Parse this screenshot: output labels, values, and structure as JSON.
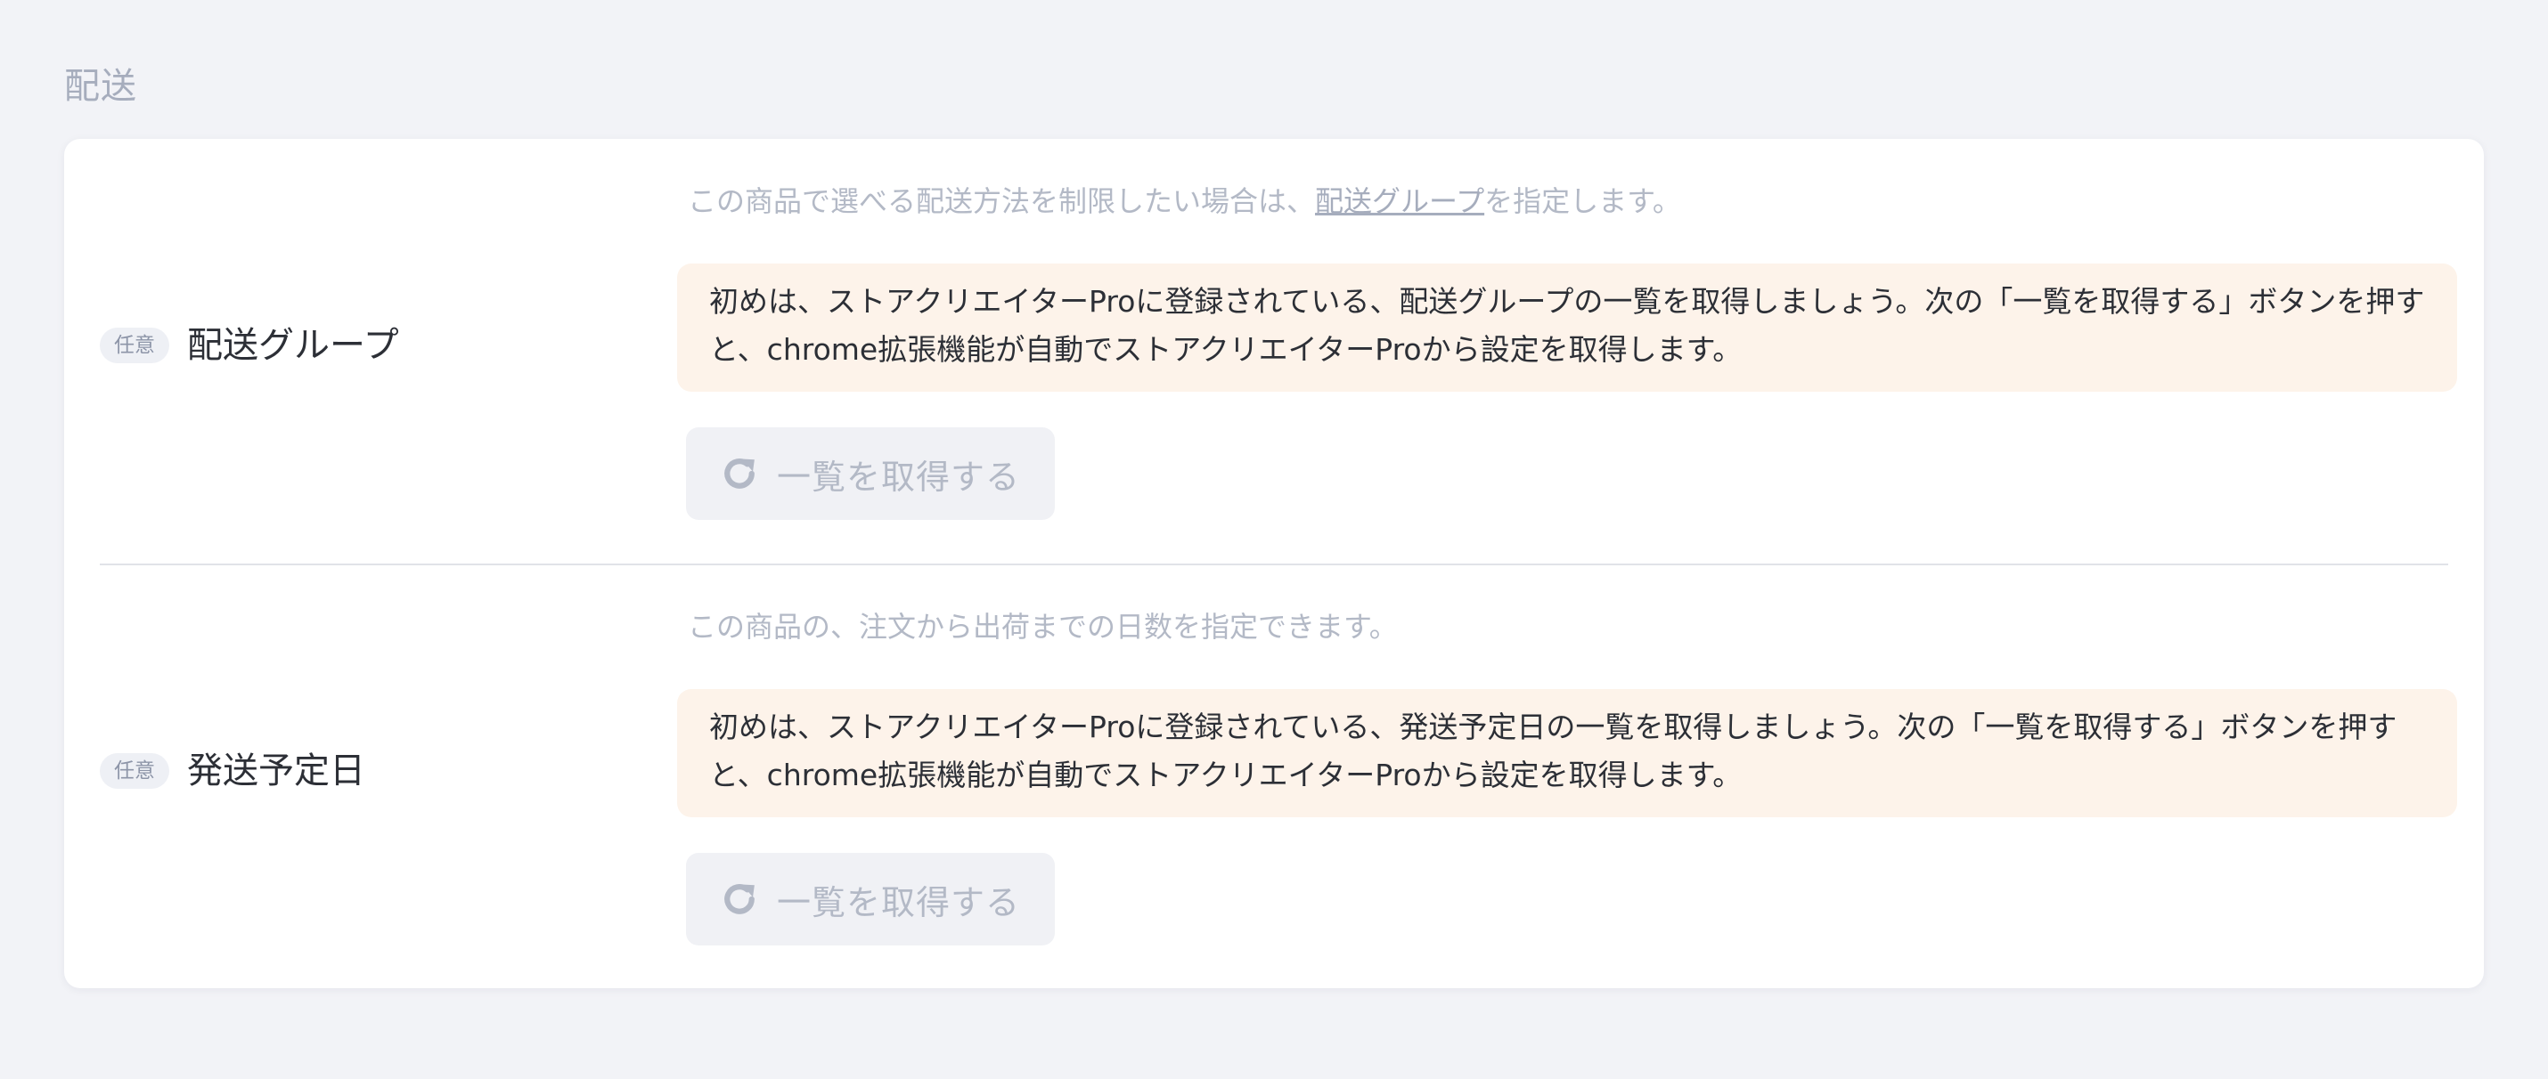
{
  "section": {
    "title": "配送"
  },
  "fields": [
    {
      "badge": "任意",
      "label": "配送グループ",
      "help_prefix": "この商品で選べる配送方法を制限したい場合は、",
      "help_link": "配送グループ",
      "help_suffix": "を指定します。",
      "notice": "初めは、ストアクリエイターProに登録されている、配送グループの一覧を取得しましょう。次の「一覧を取得する」ボタンを押すと、chrome拡張機能が自動でストアクリエイターProから設定を取得します。",
      "button_label": "一覧を取得する",
      "button_icon": "refresh-icon"
    },
    {
      "badge": "任意",
      "label": "発送予定日",
      "help_prefix": "この商品の、注文から出荷までの日数を指定できます。",
      "notice": "初めは、ストアクリエイターProに登録されている、発送予定日の一覧を取得しましょう。次の「一覧を取得する」ボタンを押すと、chrome拡張機能が自動でストアクリエイターProから設定を取得します。",
      "button_label": "一覧を取得する",
      "button_icon": "refresh-icon"
    }
  ],
  "colors": {
    "background": "#f2f3f7",
    "card": "#ffffff",
    "notice_bg": "#fdf3ea",
    "muted_text": "#b3b9c6",
    "title_text": "#a6adbd"
  }
}
